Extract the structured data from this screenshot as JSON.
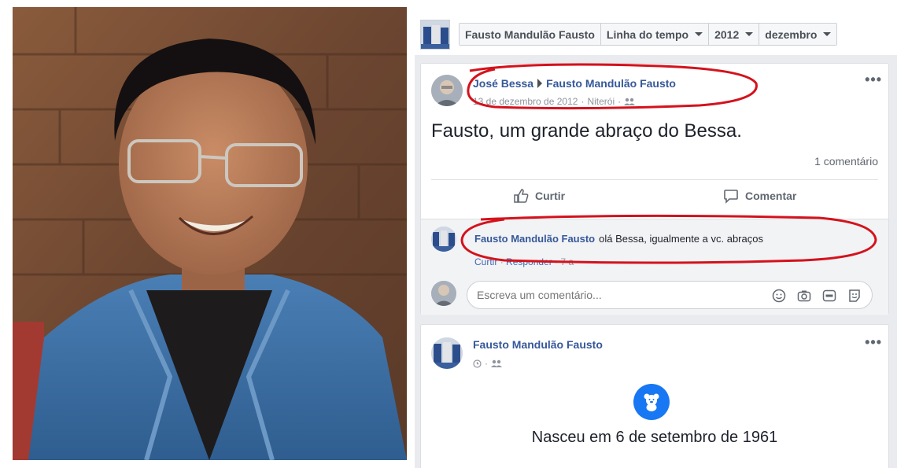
{
  "timeline_header": {
    "profile_name": "Fausto Mandulão Fausto",
    "section": "Linha do tempo",
    "year": "2012",
    "month": "dezembro"
  },
  "post1": {
    "author": "José Bessa",
    "target": "Fausto Mandulão Fausto",
    "date": "13 de dezembro de 2012",
    "location": "Niterói",
    "text": "Fausto, um grande abraço do Bessa.",
    "comments_count": "1 comentário",
    "like_label": "Curtir",
    "comment_label": "Comentar",
    "menu": "•••",
    "comment": {
      "author": "Fausto Mandulão Fausto",
      "text": "olá Bessa, igualmente a vc. abraços",
      "like": "Curtir",
      "reply": "Responder",
      "age": "7 a",
      "separator": "·"
    },
    "compose_placeholder": "Escreva um comentário...",
    "icons": [
      "emoji-icon",
      "camera-icon",
      "gif-icon",
      "sticker-icon"
    ]
  },
  "post2": {
    "author": "Fausto Mandulão Fausto",
    "menu": "•••",
    "event_text": "Nasceu em 6 de setembro de 1961"
  },
  "colors": {
    "link": "#365899",
    "annotation": "#d4121c",
    "birth_icon": "#1877f2"
  }
}
